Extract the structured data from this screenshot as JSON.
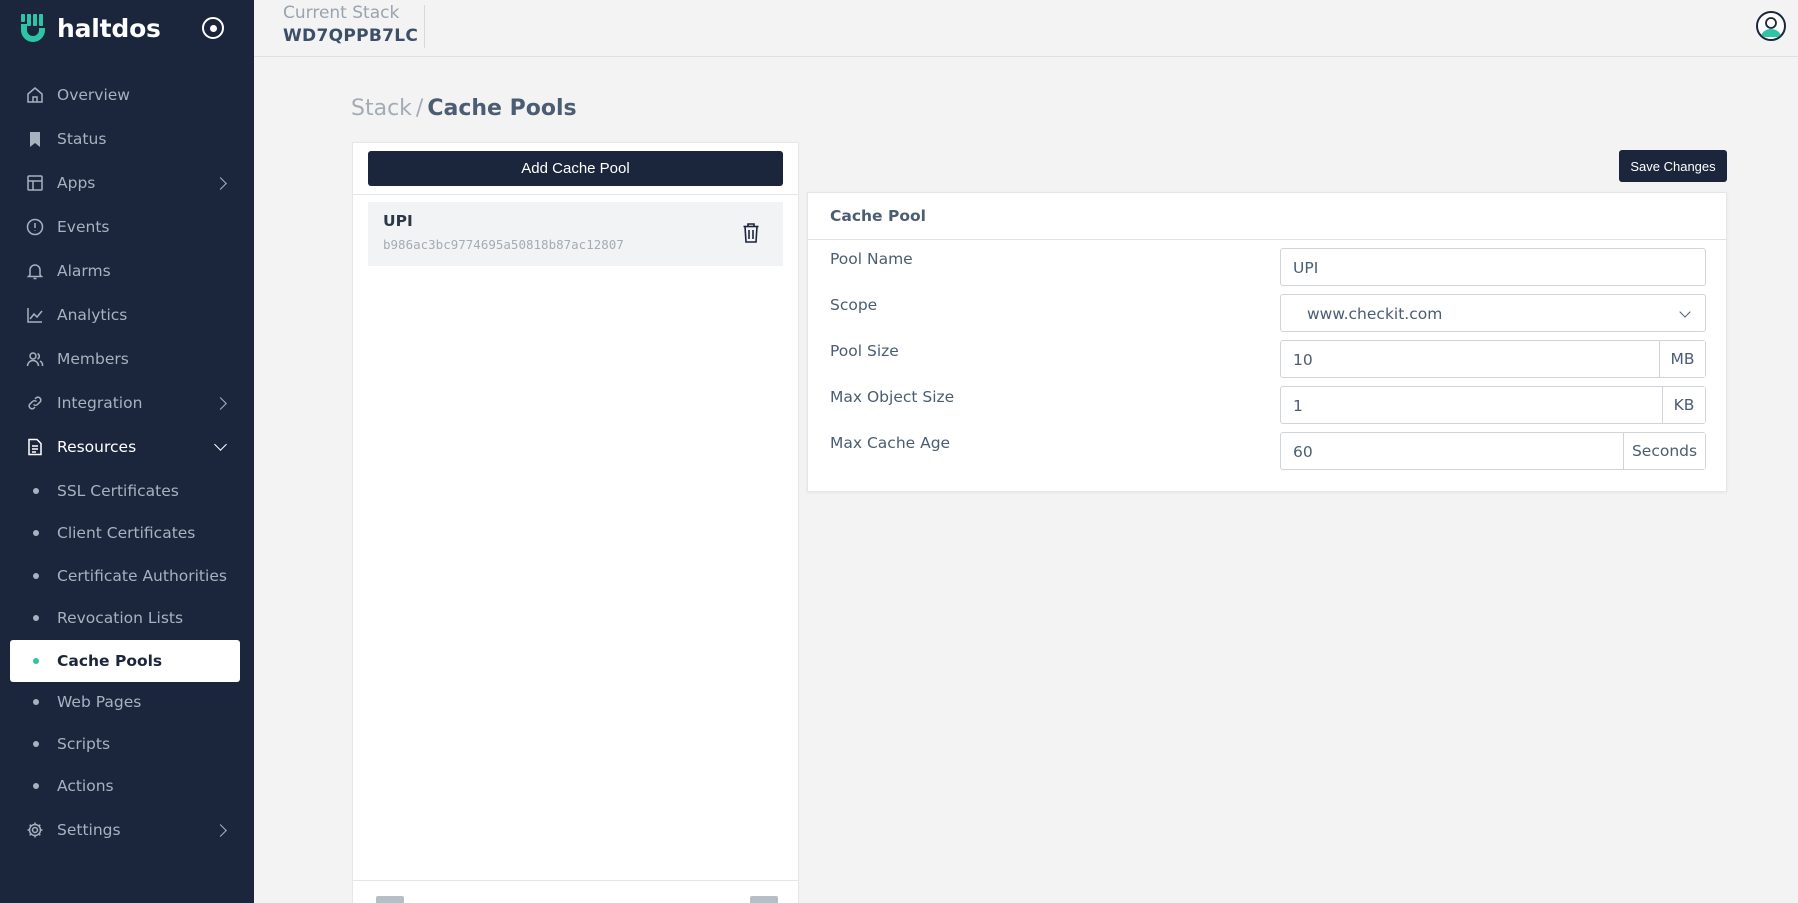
{
  "brand": {
    "name": "haltdos"
  },
  "colors": {
    "sidebar_bg": "#1b263c",
    "accent": "#2ec4a6",
    "page_bg": "#f2f3f2"
  },
  "sidebar": {
    "items": [
      {
        "label": "Overview",
        "icon": "home-icon"
      },
      {
        "label": "Status",
        "icon": "bookmark-icon"
      },
      {
        "label": "Apps",
        "icon": "layout-icon",
        "expandable": true
      },
      {
        "label": "Events",
        "icon": "alert-circle-icon"
      },
      {
        "label": "Alarms",
        "icon": "bell-icon"
      },
      {
        "label": "Analytics",
        "icon": "chart-line-icon"
      },
      {
        "label": "Members",
        "icon": "users-icon"
      },
      {
        "label": "Integration",
        "icon": "link-icon",
        "expandable": true
      },
      {
        "label": "Resources",
        "icon": "document-icon",
        "expanded": true
      },
      {
        "label": "Settings",
        "icon": "gear-icon",
        "expandable": true
      }
    ],
    "resources_sub": [
      {
        "label": "SSL Certificates"
      },
      {
        "label": "Client Certificates"
      },
      {
        "label": "Certificate Authorities"
      },
      {
        "label": "Revocation Lists"
      },
      {
        "label": "Cache Pools",
        "active": true
      },
      {
        "label": "Web Pages"
      },
      {
        "label": "Scripts"
      },
      {
        "label": "Actions"
      }
    ]
  },
  "header": {
    "stack_label": "Current Stack",
    "stack_value": "WD7QPPB7LC"
  },
  "breadcrumb": {
    "parent": "Stack",
    "separator": "/",
    "current": "Cache Pools"
  },
  "pool_list": {
    "add_label": "Add Cache Pool",
    "items": [
      {
        "name": "UPI",
        "id": "b986ac3bc9774695a50818b87ac12807"
      }
    ]
  },
  "toolbar": {
    "save_label": "Save Changes"
  },
  "form": {
    "title": "Cache Pool",
    "pool_name": {
      "label": "Pool Name",
      "value": "UPI"
    },
    "scope": {
      "label": "Scope",
      "value": "www.checkit.com"
    },
    "pool_size": {
      "label": "Pool Size",
      "value": "10",
      "unit": "MB"
    },
    "max_object_size": {
      "label": "Max Object Size",
      "value": "1",
      "unit": "KB"
    },
    "max_cache_age": {
      "label": "Max Cache Age",
      "value": "60",
      "unit": "Seconds"
    }
  }
}
